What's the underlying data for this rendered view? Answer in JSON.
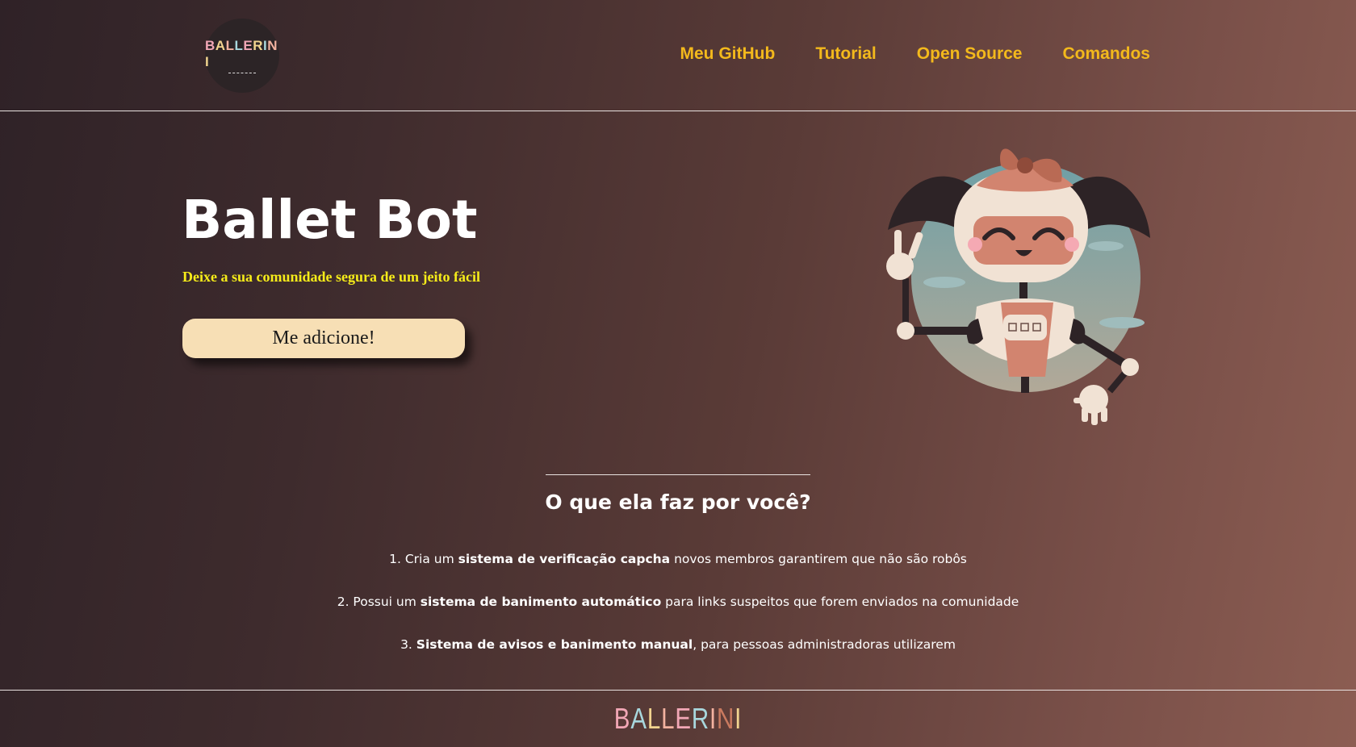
{
  "header": {
    "logo": {
      "letters": [
        "B",
        "A",
        "L",
        "L",
        "E",
        "R",
        "I",
        "N",
        "I"
      ],
      "colors": [
        "#f2a7b6",
        "#f2d48f",
        "#f3b2a0",
        "#a8d7dd",
        "#f2a7b6",
        "#f2d48f",
        "#a8d7dd",
        "#f3b2a0",
        "#f2d48f"
      ]
    },
    "nav": [
      {
        "label": "Meu GitHub"
      },
      {
        "label": "Tutorial"
      },
      {
        "label": "Open Source"
      },
      {
        "label": "Comandos"
      }
    ]
  },
  "hero": {
    "title": "Ballet Bot",
    "subtitle": "Deixe a sua comunidade segura de um jeito fácil",
    "cta_label": "Me adicione!",
    "illustration": "robot-ballerina-illustration"
  },
  "features": {
    "title": "O que ela faz por você?",
    "items": [
      {
        "before": "1. Cria um ",
        "bold": "sistema de verificação capcha",
        "after": " novos membros garantirem que não são robôs"
      },
      {
        "before": "2. Possui um ",
        "bold": "sistema de banimento automático",
        "after": " para links suspeitos que forem enviados na comunidade"
      },
      {
        "before": "3. ",
        "bold": "Sistema de avisos e banimento manual",
        "after": ", para pessoas administradoras utilizarem"
      }
    ]
  },
  "footer": {
    "logo": {
      "letters": [
        "B",
        "A",
        "L",
        "L",
        "E",
        "R",
        "I",
        "N",
        "I"
      ],
      "colors": [
        "#f2a7b6",
        "#a8d7dd",
        "#f2d48f",
        "#f3b2a0",
        "#f2a7b6",
        "#a8d7dd",
        "#f3b2a0",
        "#c97a5f",
        "#f2d48f"
      ]
    }
  },
  "colors": {
    "nav_link": "#f3b91c",
    "subtitle": "#f6ec19",
    "cta_bg": "#f7dfb5"
  }
}
